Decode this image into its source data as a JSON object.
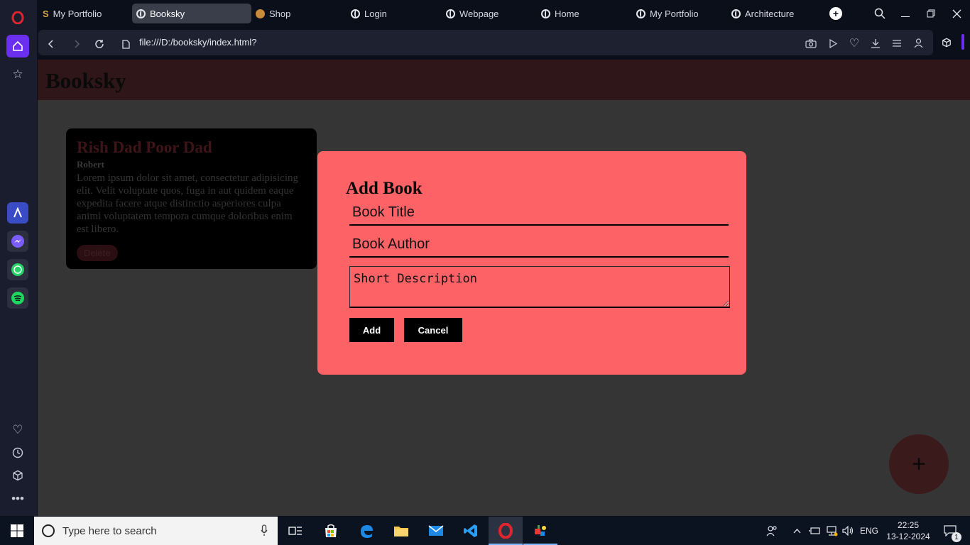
{
  "browser": {
    "tabs": [
      {
        "label": "My Portfolio",
        "icon": "portfolio-logo-icon"
      },
      {
        "label": "Booksky",
        "icon": "globe-icon",
        "active": true
      },
      {
        "label": "Shop",
        "icon": "shop-logo-icon"
      },
      {
        "label": "Login",
        "icon": "globe-icon"
      },
      {
        "label": "Webpage",
        "icon": "globe-icon"
      },
      {
        "label": "Home",
        "icon": "globe-icon"
      },
      {
        "label": "My Portfolio",
        "icon": "globe-icon"
      },
      {
        "label": "Architecture",
        "icon": "globe-icon"
      }
    ],
    "url": "file:///D:/booksky/index.html?"
  },
  "page": {
    "site_title": "Booksky",
    "book": {
      "title": "Rish Dad Poor Dad",
      "author": "Robert",
      "description": "Lorem ipsum dolor sit amet, consectetur adipisicing elit. Velit voluptate quos, fuga in aut quidem eaque expedita facere atque distinctio asperiores culpa animi voluptatem tempora cumque doloribus enim est libero.",
      "delete_label": "Delete"
    },
    "modal": {
      "title": "Add Book",
      "title_placeholder": "Book Title",
      "author_placeholder": "Book Author",
      "description_placeholder": "Short Description",
      "add_label": "Add",
      "cancel_label": "Cancel"
    },
    "fab_label": "+"
  },
  "taskbar": {
    "search_placeholder": "Type here to search",
    "language": "ENG",
    "time": "22:25",
    "date": "13-12-2024",
    "notification_count": "1"
  },
  "colors": {
    "modal_bg": "#fd6266",
    "page_bg": "#353535",
    "header_bg": "#2e1619",
    "browser_bg": "#0b0f1a"
  }
}
